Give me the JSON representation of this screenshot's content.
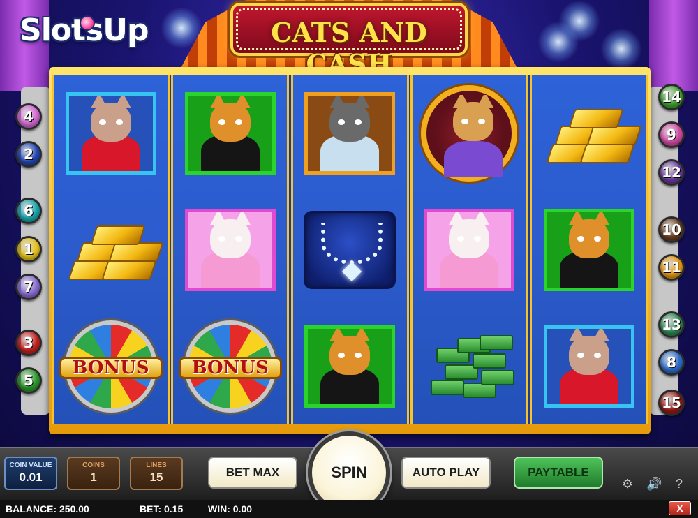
{
  "logo": {
    "text": "SlotsUp"
  },
  "game": {
    "title": "CATS AND CASH"
  },
  "reels": [
    [
      "femme-cat-red-dress",
      "gold-bars",
      "bonus-wheel"
    ],
    [
      "tabby-cat-black-suit",
      "white-persian-cat-pink",
      "bonus-wheel"
    ],
    [
      "grey-cat-mobster",
      "diamond-necklace",
      "tabby-cat-black-suit"
    ],
    [
      "singer-cat-microphone",
      "white-persian-cat-pink",
      "cash-stacks"
    ],
    [
      "gold-bars",
      "tabby-cat-black-suit",
      "femme-cat-red-dress"
    ]
  ],
  "bonus": {
    "label": "BONUS"
  },
  "paylines": {
    "left": [
      {
        "num": "4",
        "color": "#d46ad6"
      },
      {
        "num": "2",
        "color": "#2347b8"
      },
      {
        "num": "6",
        "color": "#1aa7b0"
      },
      {
        "num": "1",
        "color": "#e8c419"
      },
      {
        "num": "7",
        "color": "#8b6cd6"
      },
      {
        "num": "3",
        "color": "#c8201e"
      },
      {
        "num": "5",
        "color": "#2a9a2a"
      }
    ],
    "right": [
      {
        "num": "14",
        "color": "#3fa62e"
      },
      {
        "num": "9",
        "color": "#d64aa8"
      },
      {
        "num": "12",
        "color": "#6a3aa0"
      },
      {
        "num": "10",
        "color": "#6d3f1e"
      },
      {
        "num": "11",
        "color": "#e89a14"
      },
      {
        "num": "13",
        "color": "#2d8a54"
      },
      {
        "num": "8",
        "color": "#2c6ed0"
      },
      {
        "num": "15",
        "color": "#9a1a14"
      }
    ]
  },
  "controls": {
    "coin_value": {
      "label": "COIN VALUE",
      "value": "0.01"
    },
    "coins": {
      "label": "COINS",
      "value": "1"
    },
    "lines": {
      "label": "LINES",
      "value": "15"
    },
    "bet_max": "BET MAX",
    "spin": "SPIN",
    "auto_play": "AUTO PLAY",
    "paytable": "PAYTABLE"
  },
  "status": {
    "balance": "BALANCE: 250.00",
    "bet": "BET: 0.15",
    "win": "WIN: 0.00"
  },
  "icons": {
    "settings": "gear-icon",
    "sound": "speaker-icon",
    "help": "help-icon",
    "close": "close-icon"
  },
  "close_label": "X"
}
